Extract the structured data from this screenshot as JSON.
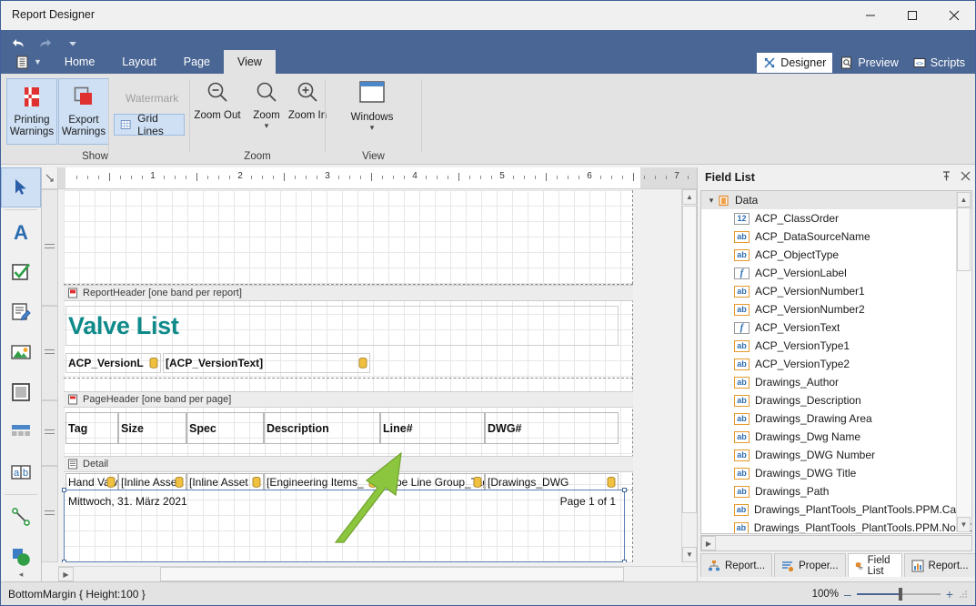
{
  "window": {
    "title": "Report Designer",
    "minimize": "–",
    "maximize": "□",
    "close": "✕"
  },
  "ribbon": {
    "tabs": [
      {
        "label": "Home",
        "active": false
      },
      {
        "label": "Layout",
        "active": false
      },
      {
        "label": "Page",
        "active": false
      },
      {
        "label": "View",
        "active": true
      }
    ],
    "view_modes": [
      {
        "label": "Designer",
        "icon": "designer-icon",
        "active": true
      },
      {
        "label": "Preview",
        "icon": "preview-icon",
        "active": false
      },
      {
        "label": "Scripts",
        "icon": "scripts-icon",
        "active": false
      }
    ],
    "groups": [
      {
        "label": "Show"
      },
      {
        "label": "Zoom"
      },
      {
        "label": "View"
      }
    ],
    "show_group": {
      "printing_warnings": "Printing\nWarnings",
      "printing_warnings_l1": "Printing",
      "printing_warnings_l2": "Warnings",
      "export_warnings_l1": "Export",
      "export_warnings_l2": "Warnings",
      "watermark": "Watermark",
      "grid_lines": "Grid Lines"
    },
    "zoom_group": {
      "zoom_out": "Zoom Out",
      "zoom": "Zoom",
      "zoom_in": "Zoom In"
    },
    "view_group": {
      "windows": "Windows"
    }
  },
  "toolbox": {
    "items": [
      {
        "name": "pointer-tool",
        "selected": true
      },
      {
        "name": "label-tool",
        "selected": false
      },
      {
        "name": "checkbox-tool",
        "selected": false
      },
      {
        "name": "rich-text-tool",
        "selected": false
      },
      {
        "name": "picture-box-tool",
        "selected": false
      },
      {
        "name": "panel-tool",
        "selected": false
      },
      {
        "name": "table-tool",
        "selected": false
      },
      {
        "name": "character-comb-tool",
        "selected": false
      },
      {
        "name": "line-tool",
        "selected": false
      },
      {
        "name": "shape-tool",
        "selected": false
      }
    ]
  },
  "ruler": {
    "marks": [
      "1",
      "2",
      "3",
      "4",
      "5",
      "6",
      "7"
    ]
  },
  "design": {
    "bands": [
      {
        "name": "top-margin",
        "label": ""
      },
      {
        "name": "report-header",
        "label": "ReportHeader [one band per report]"
      },
      {
        "name": "page-header",
        "label": "PageHeader [one band per page]"
      },
      {
        "name": "detail",
        "label": "Detail"
      }
    ],
    "report_title": "Valve List",
    "version_label": "ACP_VersionL",
    "version_text": "[ACP_VersionText]",
    "column_headers": [
      "Tag",
      "Size",
      "Spec",
      "Description",
      "Line#",
      "DWG#"
    ],
    "detail_fields": [
      "Hand Valv",
      "[Inline Asse",
      "[Inline Asset",
      "[Engineering Items_",
      "[Pipe Line Group_Tag",
      "[Drawings_DWG"
    ],
    "footer_date": "Mittwoch, 31. März 2021",
    "footer_page": "Page 1 of 1"
  },
  "field_list": {
    "title": "Field List",
    "pin_icon": "pin-icon",
    "close_icon": "close-icon",
    "root": {
      "label": "Data",
      "icon": "database-icon"
    },
    "fields": [
      {
        "label": "ACP_ClassOrder",
        "type": "12"
      },
      {
        "label": "ACP_DataSourceName",
        "type": "ab"
      },
      {
        "label": "ACP_ObjectType",
        "type": "ab"
      },
      {
        "label": "ACP_VersionLabel",
        "type": "f"
      },
      {
        "label": "ACP_VersionNumber1",
        "type": "ab"
      },
      {
        "label": "ACP_VersionNumber2",
        "type": "ab"
      },
      {
        "label": "ACP_VersionText",
        "type": "f"
      },
      {
        "label": "ACP_VersionType1",
        "type": "ab"
      },
      {
        "label": "ACP_VersionType2",
        "type": "ab"
      },
      {
        "label": "Drawings_Author",
        "type": "ab"
      },
      {
        "label": "Drawings_Description",
        "type": "ab"
      },
      {
        "label": "Drawings_Drawing Area",
        "type": "ab"
      },
      {
        "label": "Drawings_Dwg Name",
        "type": "ab"
      },
      {
        "label": "Drawings_DWG Number",
        "type": "ab"
      },
      {
        "label": "Drawings_DWG Title",
        "type": "ab"
      },
      {
        "label": "Drawings_Path",
        "type": "ab"
      },
      {
        "label": "Drawings_PlantTools_PlantTools.PPM.Category",
        "type": "ab"
      },
      {
        "label": "Drawings_PlantTools_PlantTools.PPM.NodeDispl",
        "type": "ab"
      }
    ],
    "tabs": [
      {
        "label": "Report...",
        "icon": "report-explorer-icon",
        "active": false
      },
      {
        "label": "Proper...",
        "icon": "properties-icon",
        "active": false
      },
      {
        "label": "Field List",
        "icon": "field-list-icon",
        "active": true
      },
      {
        "label": "Report...",
        "icon": "report-gallery-icon",
        "active": false
      }
    ]
  },
  "status": {
    "selection": "BottomMargin { Height:100 }",
    "zoom_level": "100%",
    "zoom_minus": "–",
    "zoom_plus": "+"
  },
  "colors": {
    "ribbon_blue": "#4a6694",
    "accent_teal": "#0f8a8a",
    "highlight": "#cfe0f5",
    "arrow_green": "#8cc63f"
  }
}
